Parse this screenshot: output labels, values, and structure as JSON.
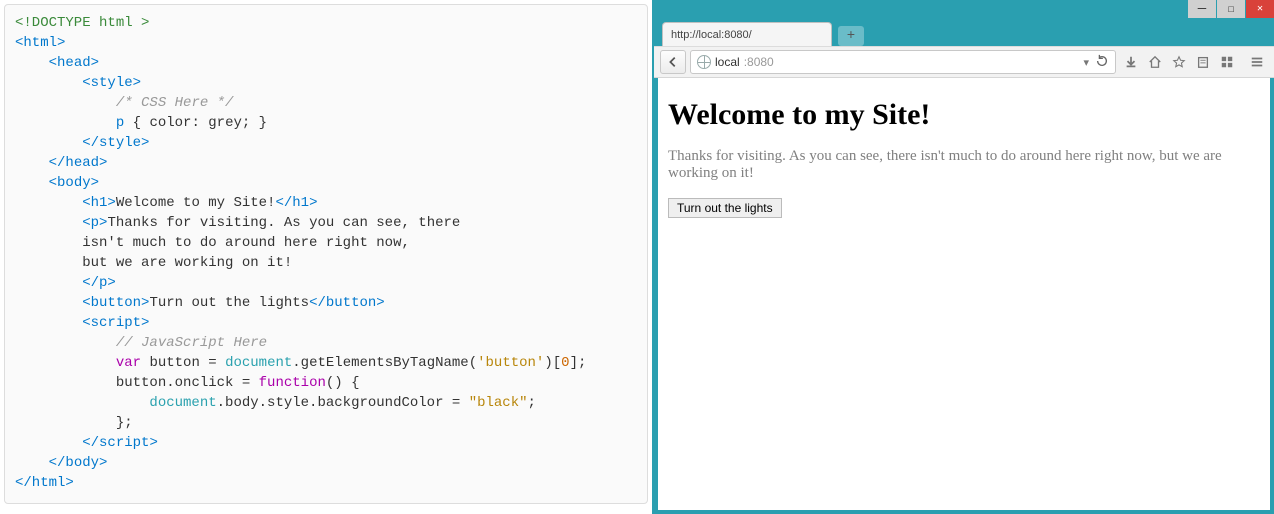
{
  "code": {
    "lines": [
      {
        "indent": 0,
        "seg": [
          {
            "c": "doctype",
            "t": "<!DOCTYPE html >"
          }
        ]
      },
      {
        "indent": 0,
        "seg": [
          {
            "c": "tag",
            "t": "<html>"
          }
        ]
      },
      {
        "indent": 1,
        "seg": [
          {
            "c": "tag",
            "t": "<head>"
          }
        ]
      },
      {
        "indent": 2,
        "seg": [
          {
            "c": "tag",
            "t": "<style>"
          }
        ]
      },
      {
        "indent": 3,
        "seg": [
          {
            "c": "comment",
            "t": "/* CSS Here */"
          }
        ]
      },
      {
        "indent": 3,
        "seg": [
          {
            "c": "ident",
            "t": "p"
          },
          {
            "c": "punct",
            "t": " { "
          },
          {
            "c": "prop",
            "t": "color"
          },
          {
            "c": "punct",
            "t": ": grey; }"
          }
        ]
      },
      {
        "indent": 2,
        "seg": [
          {
            "c": "tag",
            "t": "</style>"
          }
        ]
      },
      {
        "indent": 1,
        "seg": [
          {
            "c": "tag",
            "t": "</head>"
          }
        ]
      },
      {
        "indent": 1,
        "seg": [
          {
            "c": "tag",
            "t": "<body>"
          }
        ]
      },
      {
        "indent": 2,
        "seg": [
          {
            "c": "tag",
            "t": "<h1>"
          },
          {
            "c": "punct",
            "t": "Welcome to my Site!"
          },
          {
            "c": "tag",
            "t": "</h1>"
          }
        ]
      },
      {
        "indent": 2,
        "seg": [
          {
            "c": "tag",
            "t": "<p>"
          },
          {
            "c": "punct",
            "t": "Thanks for visiting. As you can see, there"
          }
        ]
      },
      {
        "indent": 2,
        "seg": [
          {
            "c": "punct",
            "t": "isn't much to do around here right now,"
          }
        ]
      },
      {
        "indent": 2,
        "seg": [
          {
            "c": "punct",
            "t": "but we are working on it!"
          }
        ]
      },
      {
        "indent": 2,
        "seg": [
          {
            "c": "tag",
            "t": "</p>"
          }
        ]
      },
      {
        "indent": 2,
        "seg": [
          {
            "c": "tag",
            "t": "<button>"
          },
          {
            "c": "punct",
            "t": "Turn out the lights"
          },
          {
            "c": "tag",
            "t": "</button>"
          }
        ]
      },
      {
        "indent": 2,
        "seg": [
          {
            "c": "tag",
            "t": "<script>"
          }
        ]
      },
      {
        "indent": 3,
        "seg": [
          {
            "c": "comment",
            "t": "// JavaScript Here"
          }
        ]
      },
      {
        "indent": 3,
        "seg": [
          {
            "c": "kw",
            "t": "var"
          },
          {
            "c": "punct",
            "t": " button = "
          },
          {
            "c": "js-ident",
            "t": "document"
          },
          {
            "c": "punct",
            "t": ".getElementsByTagName("
          },
          {
            "c": "str",
            "t": "'button'"
          },
          {
            "c": "punct",
            "t": ")["
          },
          {
            "c": "num",
            "t": "0"
          },
          {
            "c": "punct",
            "t": "];"
          }
        ]
      },
      {
        "indent": 3,
        "seg": [
          {
            "c": "punct",
            "t": "button.onclick = "
          },
          {
            "c": "kw",
            "t": "function"
          },
          {
            "c": "punct",
            "t": "() {"
          }
        ]
      },
      {
        "indent": 4,
        "seg": [
          {
            "c": "js-ident",
            "t": "document"
          },
          {
            "c": "punct",
            "t": ".body.style.backgroundColor = "
          },
          {
            "c": "str",
            "t": "\"black\""
          },
          {
            "c": "punct",
            "t": ";"
          }
        ]
      },
      {
        "indent": 3,
        "seg": [
          {
            "c": "punct",
            "t": "};"
          }
        ]
      },
      {
        "indent": 2,
        "seg": [
          {
            "c": "tag",
            "t": "</scr"
          },
          {
            "c": "tag",
            "t": "ipt>"
          }
        ]
      },
      {
        "indent": 1,
        "seg": [
          {
            "c": "tag",
            "t": "</body>"
          }
        ]
      },
      {
        "indent": 0,
        "seg": [
          {
            "c": "tag",
            "t": "</html>"
          }
        ]
      }
    ]
  },
  "browser": {
    "tab_title": "http://local:8080/",
    "url_host": "local",
    "url_port": ":8080",
    "dropdown_icon": "▾",
    "page": {
      "heading": "Welcome to my Site!",
      "paragraph": "Thanks for visiting. As you can see, there isn't much to do around here right now, but we are working on it!",
      "button_label": "Turn out the lights"
    }
  }
}
